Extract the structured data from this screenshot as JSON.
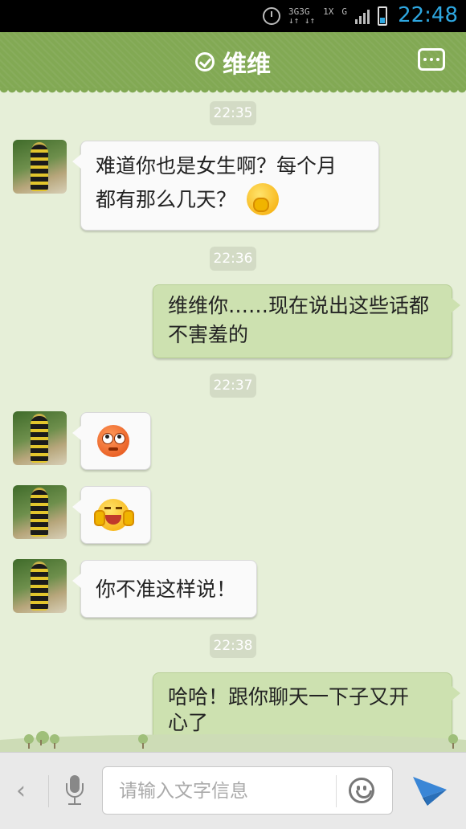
{
  "status_bar": {
    "time": "22:48",
    "network_labels": [
      "3G",
      "3G",
      "1X",
      "G"
    ]
  },
  "header": {
    "title": "维维",
    "icons": [
      "check-circle-icon",
      "more-menu-icon"
    ]
  },
  "colors": {
    "header_bg": "#82a954",
    "chat_bg": "#e6efd8",
    "incoming_bubble": "#fafafa",
    "outgoing_bubble": "#cde1b0",
    "timestamp_bg": "#d3dbc5",
    "send_icon": "#3a86d6",
    "status_time": "#2ea7e0"
  },
  "messages": [
    {
      "type": "timestamp",
      "text": "22:35"
    },
    {
      "type": "incoming",
      "line1": "难道你也是女生啊？每个月",
      "line2": "都有那么几天？",
      "emoji": "shy-face-emoji"
    },
    {
      "type": "timestamp",
      "text": "22:36"
    },
    {
      "type": "outgoing",
      "line1": "维维你……现在说出这些话都",
      "line2": "不害羞的"
    },
    {
      "type": "timestamp",
      "text": "22:37"
    },
    {
      "type": "incoming",
      "emoji": "rolling-eyes-emoji"
    },
    {
      "type": "incoming",
      "emoji": "laughing-face-emoji"
    },
    {
      "type": "incoming",
      "text": "你不准这样说！"
    },
    {
      "type": "timestamp",
      "text": "22:38"
    },
    {
      "type": "outgoing",
      "line1": "哈哈！跟你聊天一下子又开",
      "line2": "心了"
    }
  ],
  "input_bar": {
    "placeholder": "请输入文字信息",
    "back_label": "‹",
    "icons": [
      "back-arrow-icon",
      "microphone-icon",
      "smiley-icon",
      "send-icon"
    ]
  }
}
